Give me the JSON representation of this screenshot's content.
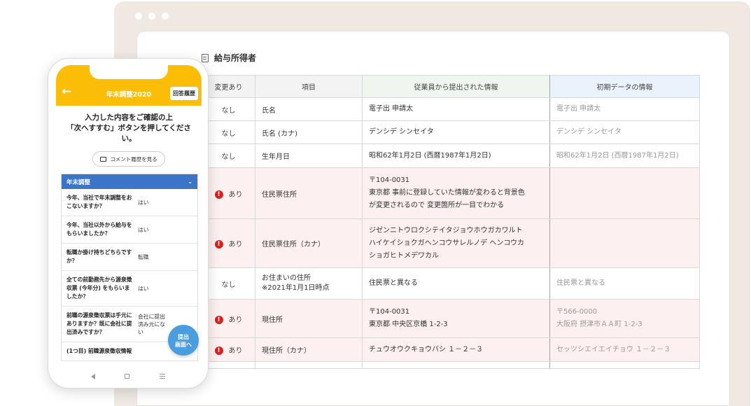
{
  "pane": {
    "title": "給与所得者"
  },
  "table": {
    "headers": {
      "change": "変更あり",
      "item": "項目",
      "employee": "従業員から提出された情報",
      "initial": "初期データの情報"
    },
    "rows": [
      {
        "change": "なし",
        "item": "氏名",
        "employee": "電子出 申請太",
        "initial": "電子出 申請太"
      },
      {
        "change": "なし",
        "item": "氏名 (カナ)",
        "employee": "デンシデ シンセイタ",
        "initial": "デンシデ シンセイタ"
      },
      {
        "change": "なし",
        "item": "生年月日",
        "employee": "昭和62年1月2日 (西暦1987年1月2日)",
        "initial": "昭和62年1月2日 (西暦1987年1月2日)"
      },
      {
        "change": "あり",
        "item": "住民票住所",
        "employee_lines": [
          "〒104-0031",
          "東京都 事前に登録していた情報が変わると背景色",
          "が変更されるので 変更箇所が一目でわかる"
        ],
        "initial": ""
      },
      {
        "change": "あり",
        "item": "住民票住所（カナ）",
        "employee_lines": [
          "ジゼンニトウロクシテイタジョウホウガカワルト",
          "ハイケイショクガヘンコウサレルノデ ヘンコウカ",
          "ショガヒトメデワカル"
        ],
        "initial": ""
      },
      {
        "change": "なし",
        "item_lines": [
          "お住まいの住所",
          "※2021年1月1日時点"
        ],
        "employee": "住民票と異なる",
        "initial": "住民票と異なる"
      },
      {
        "change": "あり",
        "item": "現住所",
        "employee_lines": [
          "〒104-0031",
          "東京都 中央区京橋 1-2-3"
        ],
        "initial_lines": [
          "〒566-0000",
          "大阪府 摂津市ＡＡ町 1-2-3"
        ]
      },
      {
        "change": "あり",
        "item": "現住所（カナ）",
        "employee": "チュウオウクキョウバシ １－２－３",
        "initial": "セッツシエイエイチョウ １－２－３"
      }
    ]
  },
  "phone": {
    "header_title": "年末調整2020",
    "history_button": "回答履歴",
    "message_lines": [
      "入力した内容をご確認の上",
      "「次へすすむ」ボタンを押してくださ",
      "い。"
    ],
    "comment_button": "コメント履歴を見る",
    "section_title": "年末調整",
    "qa": [
      {
        "q": "今年、当社で年末調整をおこないますか？",
        "a": "はい"
      },
      {
        "q": "今年、当社以外から給与をもらいましたか？",
        "a": "はい"
      },
      {
        "q": "転職か掛け持ちどちらですか？",
        "a": "転職"
      },
      {
        "q": "全ての前勤務先から源泉徴収票 (今年分) をもらいましたか？",
        "a": "はい"
      },
      {
        "q": "前職の源泉徴収票は手元にありますか？既に会社に提出済みですか？",
        "a": "会社に提出済み元にない"
      },
      {
        "q": "(1つ目) 前職源泉徴収情報",
        "a": ""
      }
    ],
    "fab_lines": [
      "提出",
      "画面へ"
    ]
  }
}
